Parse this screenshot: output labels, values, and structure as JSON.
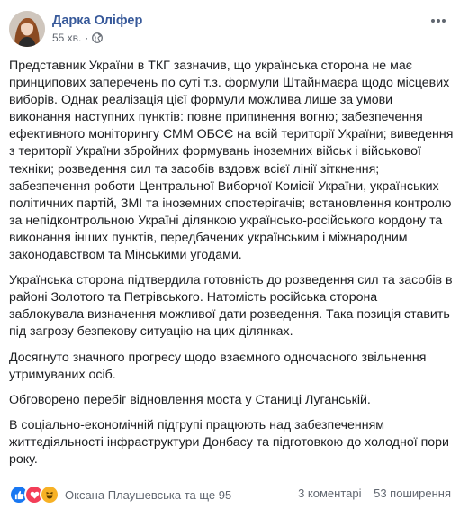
{
  "post": {
    "author": "Дарка Оліфер",
    "time": "55 хв.",
    "separator": "·",
    "audience_icon": "globe-icon",
    "more_icon": "more-horizontal-icon",
    "paragraphs": [
      "Представник України в ТКГ зазначив, що українська сторона не має принципових заперечень по суті т.з. формули Штайнмаєра щодо місцевих виборів. Однак реалізація цієї формули можлива лише за умови виконання наступних пунктів: повне припинення вогню; забезпечення ефективного моніторингу СММ ОБСЄ на всій території України; виведення з території України збройних формувань іноземних військ і військової техніки; розведення сил та засобів вздовж всієї лінії зіткнення; забезпечення роботи Центральної Виборчої Комісії України, українських політичних партій, ЗМІ та іноземних спостерігачів; встановлення контролю за непідконтрольною Україні ділянкою українсько-російського кордону та виконання інших пунктів, передбачених українським і міжнародним законодавством та Мінськими угодами.",
      "Українська сторона підтвердила готовність до розведення сил та засобів в районі Золотого та Петрівського. Натомість російська сторона заблокувала визначення можливої дати розведення. Така позиція ставить під загрозу безпекову ситуацію на цих ділянках.",
      "Досягнуто значного прогресу щодо взаємного одночасного звільнення утримуваних осіб.",
      "Обговорено перебіг відновлення моста у Станиці Луганській.",
      "В соціально-економічній підгрупі працюють над забезпеченням життєдіяльності інфраструктури Донбасу та підготовкою до холодної пори року."
    ],
    "reactions": {
      "icons": [
        "like-reaction-icon",
        "love-reaction-icon",
        "haha-reaction-icon"
      ],
      "colors": {
        "like": "#1877f2",
        "love": "#f33e58",
        "haha": "#f7b125"
      },
      "names": "Оксана Плаушевська та ще 95"
    },
    "comments": "3 коментарі",
    "shares": "53 поширення"
  }
}
